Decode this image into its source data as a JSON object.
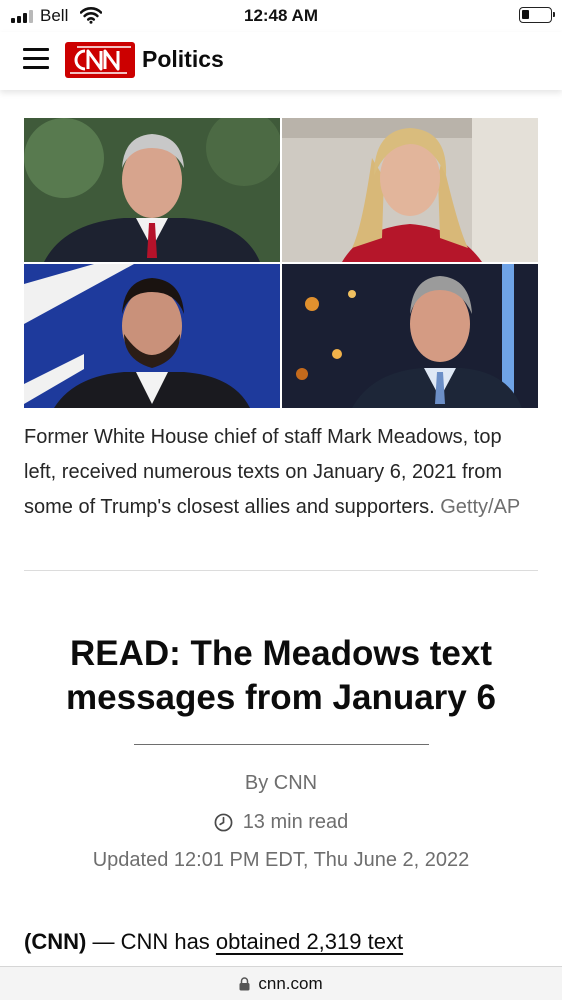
{
  "status_bar": {
    "carrier": "Bell",
    "time": "12:48 AM",
    "icons": [
      "signal-icon",
      "wifi-icon",
      "battery-icon"
    ]
  },
  "header": {
    "brand": "CNN",
    "section": "Politics",
    "brand_color": "#cc0000",
    "icons": [
      "menu-icon",
      "cnn-logo"
    ]
  },
  "photo": {
    "caption": "Former White House chief of staff Mark Meadows, top left, received numerous texts on January 6, 2021 from some of Trump's closest allies and supporters.",
    "credit": "Getty/AP"
  },
  "article": {
    "headline": "READ: The Meadows text messages from January 6",
    "byline": "By CNN",
    "read_time": "13 min read",
    "updated": "Updated 12:01 PM EDT, Thu June 2, 2022",
    "body_source": "(CNN)",
    "body_dash": " — ",
    "body_text": "CNN has ",
    "body_link": "obtained 2,319 text"
  },
  "browser": {
    "url": "cnn.com",
    "icons": [
      "lock-icon"
    ]
  },
  "colors": {
    "text": "#0c0c0c",
    "meta_gray": "#6e6e6e",
    "url_bar": "#f4f4f4"
  }
}
